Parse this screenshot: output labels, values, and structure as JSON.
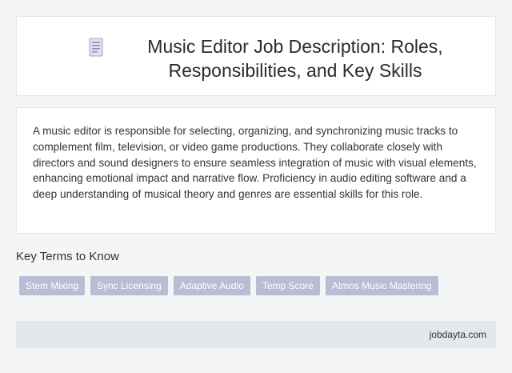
{
  "header": {
    "title": "Music Editor Job Description: Roles, Responsibilities, and Key Skills",
    "icon": "document-icon"
  },
  "description": {
    "text": "A music editor is responsible for selecting, organizing, and synchronizing music tracks to complement film, television, or video game productions. They collaborate closely with directors and sound designers to ensure seamless integration of music with visual elements, enhancing emotional impact and narrative flow. Proficiency in audio editing software and a deep understanding of musical theory and genres are essential skills for this role."
  },
  "key_terms": {
    "heading": "Key Terms to Know",
    "items": [
      "Stem Mixing",
      "Sync Licensing",
      "Adaptive Audio",
      "Temp Score",
      "Atmos Music Mastering"
    ]
  },
  "footer": {
    "site": "jobdayta.com"
  },
  "colors": {
    "background": "#f3f5f7",
    "card": "#ffffff",
    "chip": "#b8bdd3",
    "footer": "#e3e8ec"
  }
}
